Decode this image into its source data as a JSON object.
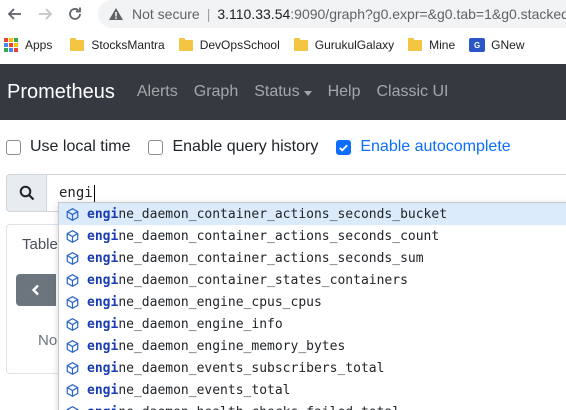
{
  "browser": {
    "not_secure": "Not secure",
    "separator": "|",
    "url_host": "3.110.33.54",
    "url_rest": ":9090/graph?g0.expr=&g0.tab=1&g0.stacked"
  },
  "bookmarks": {
    "apps": "Apps",
    "items": [
      "StocksMantra",
      "DevOpsSchool",
      "GurukulGalaxy",
      "Mine",
      "GNew"
    ]
  },
  "navbar": {
    "brand": "Prometheus",
    "links": [
      "Alerts",
      "Graph",
      "Status",
      "Help",
      "Classic UI"
    ]
  },
  "options": {
    "local_time": "Use local time",
    "query_history": "Enable query history",
    "autocomplete": "Enable autocomplete",
    "autocomplete_checked": true
  },
  "expression": {
    "value": "engi"
  },
  "panel": {
    "tab_label": "Table",
    "no_data_prefix": "No"
  },
  "autocomplete": {
    "match": "engi",
    "suggestions": [
      {
        "match": "engi",
        "rest": "ne_daemon_container_actions_seconds_bucket"
      },
      {
        "match": "engi",
        "rest": "ne_daemon_container_actions_seconds_count"
      },
      {
        "match": "engi",
        "rest": "ne_daemon_container_actions_seconds_sum"
      },
      {
        "match": "engi",
        "rest": "ne_daemon_container_states_containers"
      },
      {
        "match": "engi",
        "rest": "ne_daemon_engine_cpus_cpus"
      },
      {
        "match": "engi",
        "rest": "ne_daemon_engine_info"
      },
      {
        "match": "engi",
        "rest": "ne_daemon_engine_memory_bytes"
      },
      {
        "match": "engi",
        "rest": "ne_daemon_events_subscribers_total"
      },
      {
        "match": "engi",
        "rest": "ne_daemon_events_total"
      },
      {
        "match": "engi",
        "rest": "ne_daemon_health_checks_failed_total"
      }
    ]
  },
  "colors": {
    "navbar_bg": "#343a40",
    "accent": "#0d6efd",
    "match_highlight": "#1a3cb3",
    "active_row": "#dcebfc"
  },
  "icons": {
    "back": "arrow-left-icon",
    "forward": "arrow-right-icon",
    "reload": "reload-icon",
    "warning": "warning-triangle-icon",
    "search": "search-icon",
    "metric": "cube-icon"
  }
}
